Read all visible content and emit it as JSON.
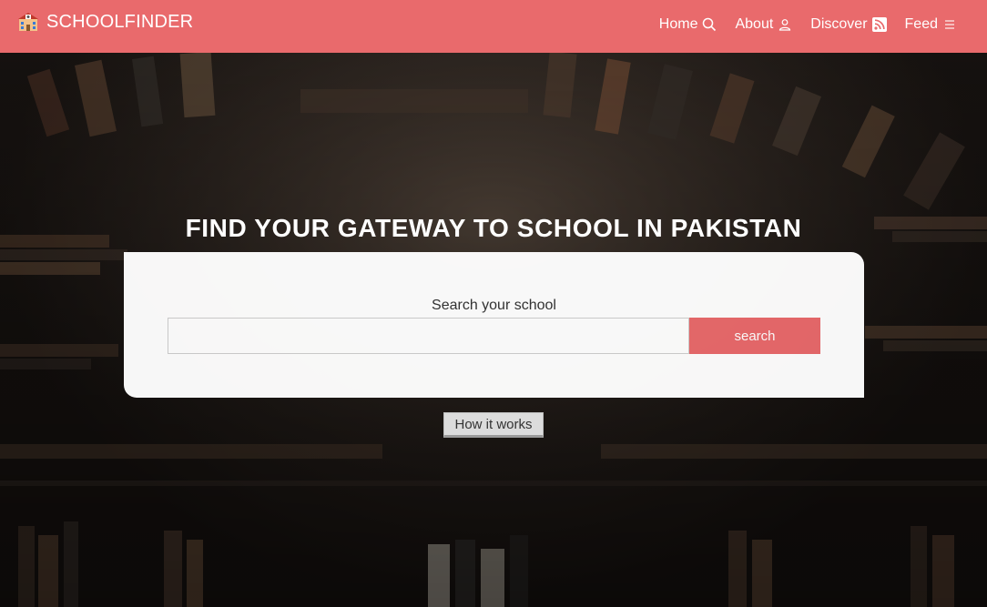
{
  "brand": {
    "name": "SCHOOLFINDER",
    "icon": "school-building-icon"
  },
  "nav": {
    "items": [
      {
        "label": "Home",
        "icon": "search-icon"
      },
      {
        "label": "About",
        "icon": "user-icon"
      },
      {
        "label": "Discover",
        "icon": "rss-feed-icon"
      },
      {
        "label": "Feed",
        "icon": "menu-lines-icon"
      }
    ]
  },
  "hero": {
    "title": "FIND YOUR GATEWAY TO SCHOOL IN PAKISTAN",
    "background": "library-bookshelves-photo"
  },
  "search": {
    "label": "Search your school",
    "value": "",
    "placeholder": "",
    "button_label": "search"
  },
  "how_it_works": {
    "label": "How it works"
  },
  "colors": {
    "accent": "#e96a6c",
    "panel": "#ffffff",
    "button_gray": "#dcdcdc"
  }
}
